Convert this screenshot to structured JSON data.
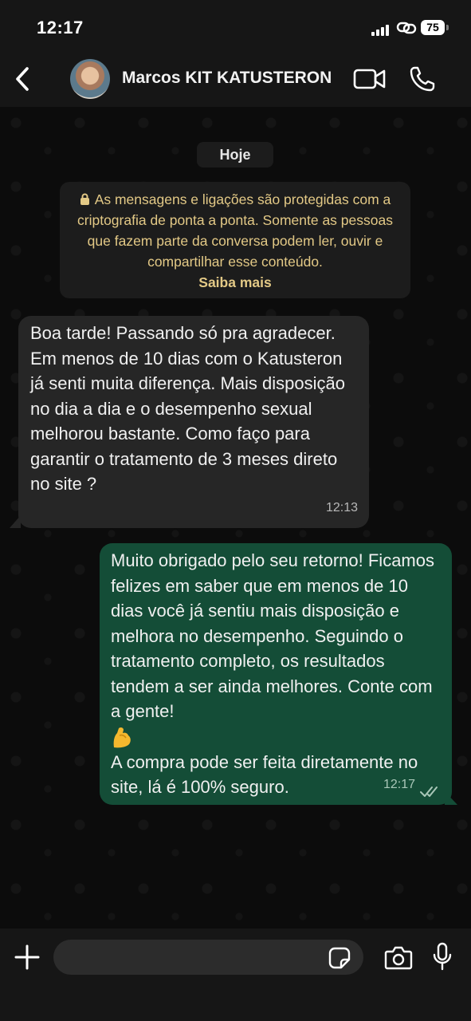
{
  "status_bar": {
    "time": "12:17",
    "battery": "75"
  },
  "header": {
    "contact_name": "Marcos KIT KATUSTERON",
    "icons": {
      "back": "chevron-left-icon",
      "video": "video-camera-icon",
      "call": "phone-icon"
    }
  },
  "chat": {
    "date_label": "Hoje",
    "encryption_notice": {
      "text": "As mensagens e ligações são protegidas com a criptografia de ponta a ponta. Somente as pessoas que fazem parte da conversa podem ler, ouvir e compartilhar esse conteúdo.",
      "link": "Saiba mais"
    },
    "messages": [
      {
        "direction": "incoming",
        "text": "Boa tarde! Passando só pra agradecer. Em menos de 10 dias com o Katusteron já senti muita diferença. Mais disposição no dia a dia e o desempenho sexual melhorou bastante. Como faço para garantir o tratamento de 3 meses direto no site ?",
        "time": "12:13"
      },
      {
        "direction": "outgoing",
        "text": "Muito obrigado pelo seu retorno! Ficamos felizes em saber que em menos de 10 dias você já sentiu mais disposição e melhora no desempenho. Seguindo o tratamento completo, os resultados tendem a ser ainda melhores. Conte com a gente!",
        "emoji": "flexed-biceps-emoji",
        "text_after": "A compra pode ser feita diretamente no site, lá é 100% seguro.",
        "time": "12:17",
        "status": "read-double-check-icon"
      }
    ]
  },
  "composer": {
    "placeholder": "",
    "icons": {
      "add": "plus-icon",
      "sticker": "sticker-icon",
      "camera": "camera-icon",
      "mic": "microphone-icon"
    }
  }
}
